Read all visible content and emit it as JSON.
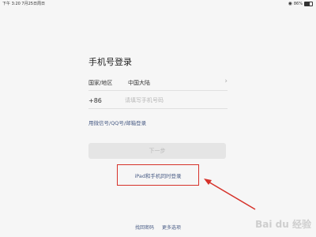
{
  "status_bar": {
    "time": "下午 3:20",
    "date": "7月25日周日",
    "battery": "86%"
  },
  "login": {
    "title": "手机号登录",
    "region_label": "国家/地区",
    "region_value": "中国大陆",
    "country_code": "+86",
    "phone_placeholder": "请填写手机号码",
    "alt_login": "用微信号/QQ号/邮箱登录",
    "next_button": "下一步",
    "ipad_login": "iPad和手机同时登录"
  },
  "footer": {
    "retrieve_password": "找回密码",
    "more_options": "更多选项"
  },
  "watermark": "Bai du 经验",
  "colors": {
    "background": "#f6f6f6",
    "link": "#4a5d86",
    "highlight": "#d6322a",
    "button_disabled": "#e5e5e5"
  }
}
